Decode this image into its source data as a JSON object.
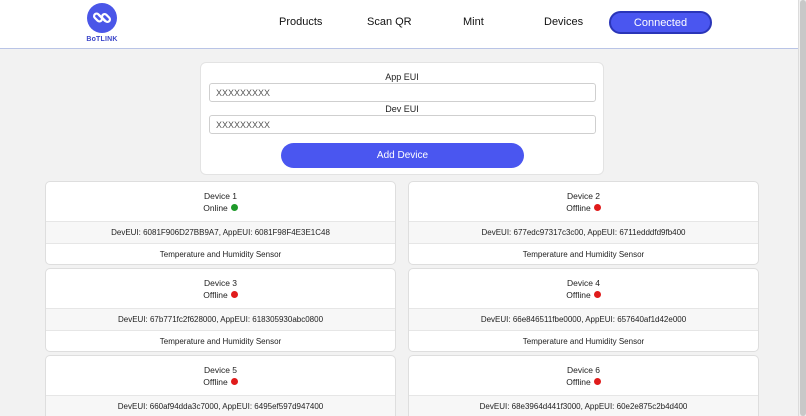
{
  "header": {
    "logo_text": "BoTLINK",
    "nav": [
      {
        "label": "Products"
      },
      {
        "label": "Scan QR"
      },
      {
        "label": "Mint"
      },
      {
        "label": "Devices"
      }
    ],
    "connected_label": "Connected"
  },
  "form": {
    "app_eui_label": "App EUI",
    "app_eui_placeholder": "XXXXXXXXX",
    "dev_eui_label": "Dev EUI",
    "dev_eui_placeholder": "XXXXXXXXX",
    "add_button": "Add Device"
  },
  "colors": {
    "accent": "#4a56f0",
    "online": "#1e9a2a",
    "offline": "#e01b1b"
  },
  "devices": [
    {
      "name": "Device 1",
      "status": "Online",
      "ids": "DevEUI: 6081F906D27BB9A7, AppEUI: 6081F98F4E3E1C48",
      "type": "Temperature and Humidity Sensor"
    },
    {
      "name": "Device 2",
      "status": "Offline",
      "ids": "DevEUI: 677edc97317c3c00, AppEUI: 6711edddfd9fb400",
      "type": "Temperature and Humidity Sensor"
    },
    {
      "name": "Device 3",
      "status": "Offline",
      "ids": "DevEUI: 67b771fc2f628000, AppEUI: 618305930abc0800",
      "type": "Temperature and Humidity Sensor"
    },
    {
      "name": "Device 4",
      "status": "Offline",
      "ids": "DevEUI: 66e846511fbe0000, AppEUI: 657640af1d42e000",
      "type": "Temperature and Humidity Sensor"
    },
    {
      "name": "Device 5",
      "status": "Offline",
      "ids": "DevEUI: 660af94dda3c7000, AppEUI: 6495ef597d947400",
      "type": ""
    },
    {
      "name": "Device 6",
      "status": "Offline",
      "ids": "DevEUI: 68e3964d441f3000, AppEUI: 60e2e875c2b4d400",
      "type": ""
    }
  ]
}
